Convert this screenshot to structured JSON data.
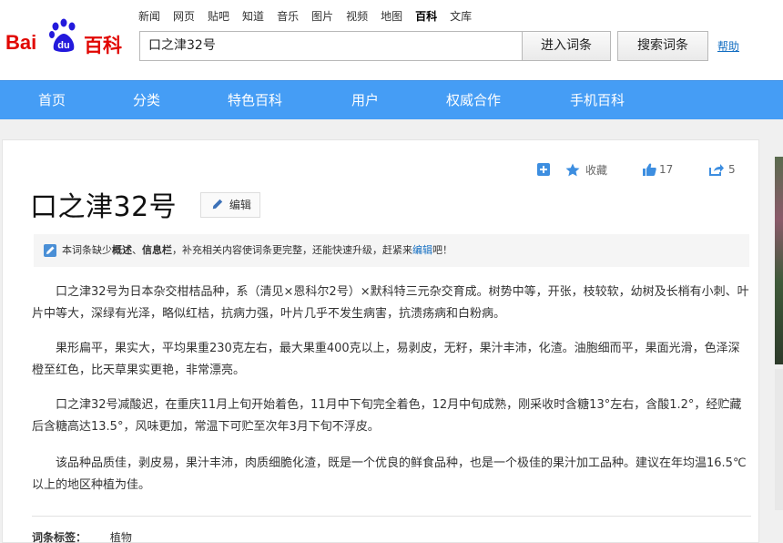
{
  "logo": {
    "part1": "Bai",
    "part2": "du",
    "part3": "百科"
  },
  "topnav": [
    "新闻",
    "网页",
    "贴吧",
    "知道",
    "音乐",
    "图片",
    "视频",
    "地图",
    "百科",
    "文库"
  ],
  "topnav_active": "百科",
  "search": {
    "value": "口之津32号",
    "enter_label": "进入词条",
    "search_label": "搜索词条",
    "help_label": "帮助"
  },
  "mainnav": [
    "首页",
    "分类",
    "特色百科",
    "用户",
    "权威合作",
    "手机百科"
  ],
  "tools": {
    "favorite_label": "收藏",
    "like_count": "17",
    "share_count": "5"
  },
  "article": {
    "title": "口之津32号",
    "edit_label": "编辑",
    "notice": {
      "prefix": "本词条缺少",
      "item1": "概述",
      "sep": "、",
      "item2": "信息栏",
      "middle": "，补充相关内容使词条更完整，还能快速升级，赶紧来",
      "link": "编辑",
      "suffix": "吧！"
    },
    "paragraphs": [
      "口之津32号为日本杂交柑桔品种，系（清见×恩科尔2号）×默科特三元杂交育成。树势中等，开张，枝较软，幼树及长梢有小刺、叶片中等大，深绿有光泽，略似红桔，抗病力强，叶片几乎不发生病害，抗溃疡病和白粉病。",
      "果形扁平，果实大，平均果重230克左右，最大果重400克以上，易剥皮，无籽，果汁丰沛，化渣。油胞细而平，果面光滑，色泽深橙至红色，比天草果实更艳，非常漂亮。",
      "口之津32号减酸迟，在重庆11月上旬开始着色，11月中下旬完全着色，12月中旬成熟，刚采收时含糖13°左右，含酸1.2°，经贮藏后含糖高达13.5°，风味更加，常温下可贮至次年3月下旬不浮皮。",
      "该品种品质佳，剥皮易，果汁丰沛，肉质细脆化渣，既是一个优良的鲜食品种，也是一个极佳的果汁加工品种。建议在年均温16.5℃以上的地区种植为佳。"
    ],
    "tags_label": "词条标签：",
    "tags": [
      "植物"
    ]
  },
  "colors": {
    "brand_red": "#e10601",
    "brand_blue": "#2319dc",
    "nav_blue": "#459df5",
    "link_blue": "#136ec2"
  }
}
